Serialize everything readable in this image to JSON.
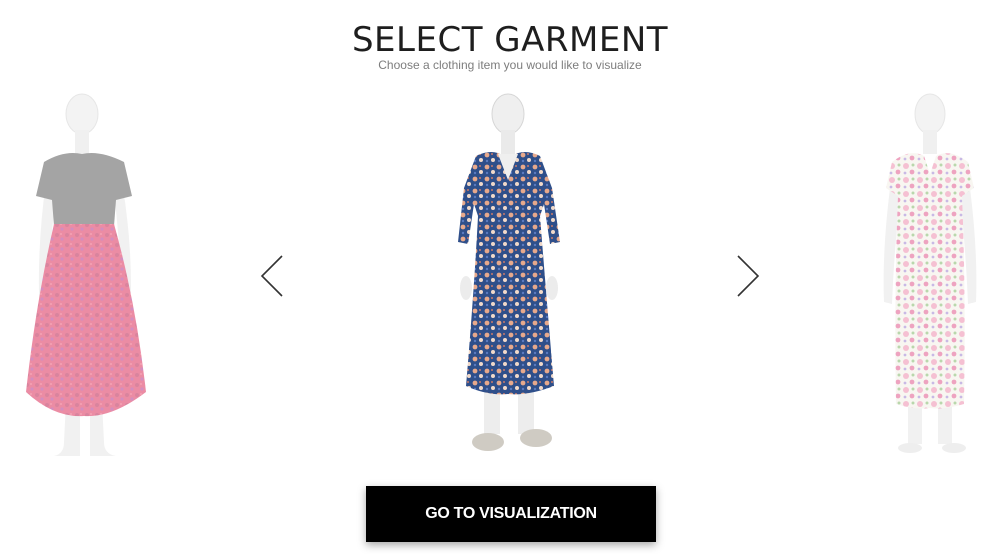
{
  "header": {
    "title": "SELECT GARMENT",
    "subtitle": "Choose a clothing item you would like to visualize"
  },
  "carousel": {
    "items": [
      {
        "position": "previous",
        "garment": "short-sleeve top with pink floral skirt"
      },
      {
        "position": "selected",
        "garment": "blue floral wrap dress"
      },
      {
        "position": "next",
        "garment": "white floral dress with pink roses"
      }
    ],
    "prev_icon": "chevron-left-icon",
    "next_icon": "chevron-right-icon"
  },
  "actions": {
    "go_to_visualization_label": "GO TO VISUALIZATION"
  },
  "colors": {
    "title": "#1e1e1e",
    "subtitle": "#7d7d7d",
    "button_bg": "#000000",
    "button_text": "#ffffff",
    "mannequin": "#ececec"
  }
}
